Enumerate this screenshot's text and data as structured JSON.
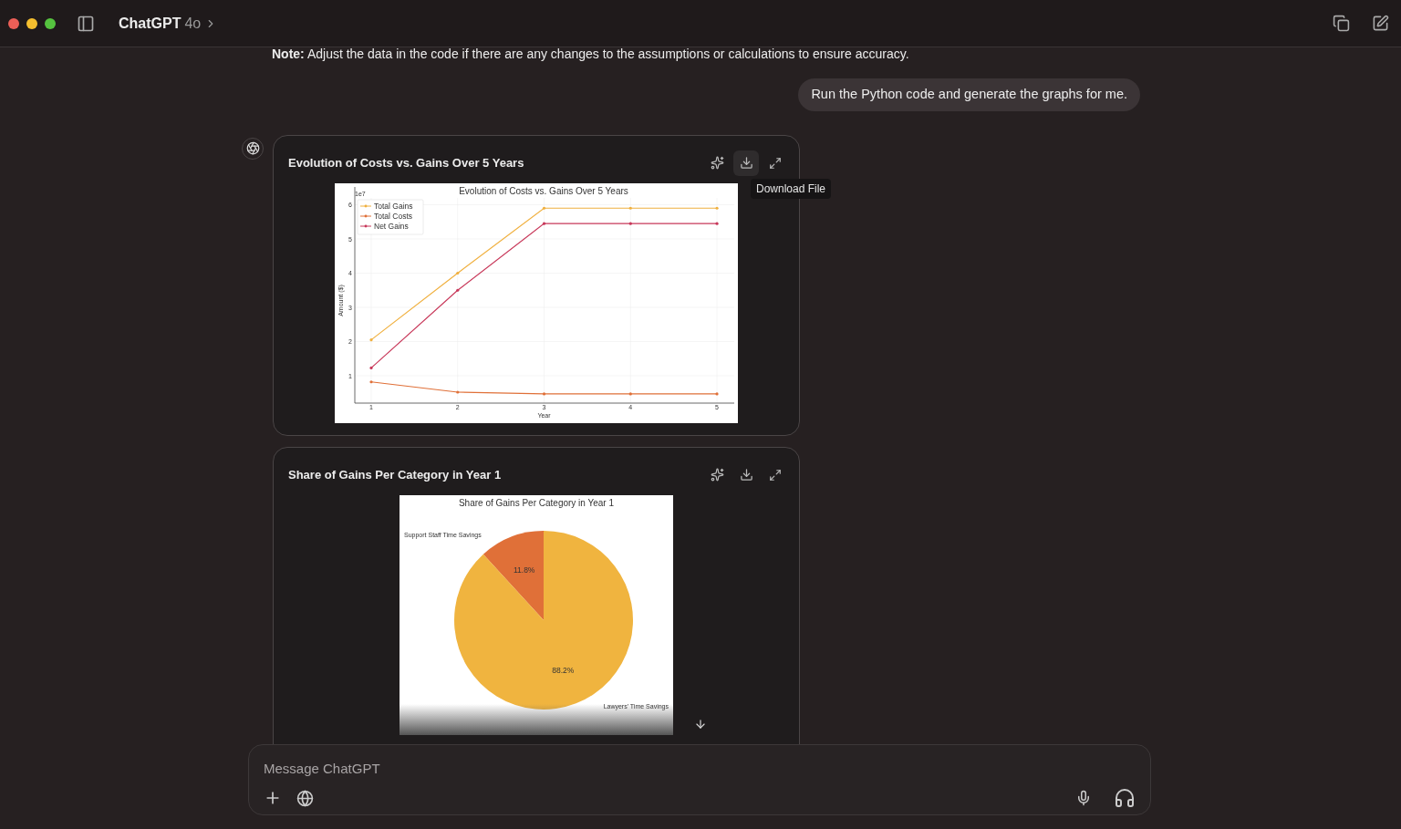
{
  "window": {
    "title": "ChatGPT",
    "model": "4o"
  },
  "note": "**Note:** Adjust the data in the code if there are any changes to the assumptions or calculations to ensure accuracy.",
  "user_message": "Run the Python code and generate the graphs for me.",
  "images": [
    {
      "title": "Evolution of Costs vs. Gains Over 5 Years",
      "tooltip": "Download File",
      "chart_data": {
        "type": "line",
        "title": "Evolution of Costs vs. Gains Over 5 Years",
        "xlabel": "Year",
        "ylabel": "Amount ($)",
        "annotations": [
          {
            "text": "1e7"
          }
        ],
        "grid": true,
        "legend": true,
        "xlim": [
          0.81,
          5.2
        ],
        "x": [
          1,
          2,
          3,
          4,
          5
        ],
        "xticks": [
          1,
          2,
          3,
          4,
          5
        ],
        "yticks": [
          1,
          2,
          3,
          4,
          5,
          6
        ],
        "ylim": [
          0.2,
          6.2
        ],
        "series": [
          {
            "name": "Total Gains",
            "color": "#f0b03f",
            "values": [
              2.05,
              4.0,
              5.9,
              5.9,
              5.9
            ]
          },
          {
            "name": "Total Costs",
            "color": "#e07038",
            "values": [
              0.82,
              0.52,
              0.47,
              0.47,
              0.47
            ]
          },
          {
            "name": "Net Gains",
            "color": "#c8385a",
            "values": [
              1.23,
              3.5,
              5.45,
              5.45,
              5.45
            ]
          }
        ]
      }
    },
    {
      "title": "Share of Gains Per Category in Year 1",
      "chart_data": {
        "type": "pie",
        "title": "Share of Gains Per Category in Year 1",
        "categories": [
          "Support Staff Time Savings",
          "Lawyers' Time Savings"
        ],
        "colors": [
          "#e07038",
          "#f0b43f"
        ],
        "values": [
          11.8,
          88.2
        ],
        "value_labels": [
          "11.8%",
          "88.2%"
        ]
      }
    }
  ],
  "composer": {
    "placeholder": "Message ChatGPT"
  }
}
